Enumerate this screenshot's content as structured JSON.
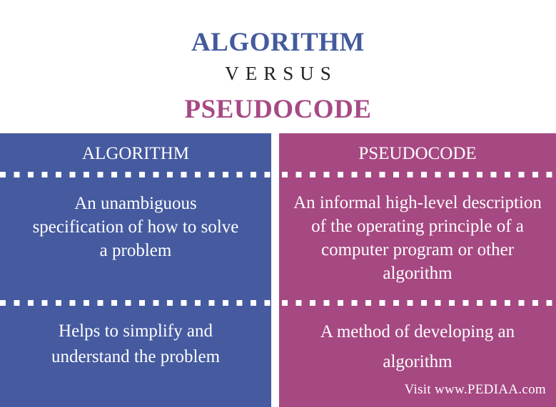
{
  "title": {
    "left": "ALGORITHM",
    "versus": "VERSUS",
    "right": "PSEUDOCODE"
  },
  "colors": {
    "algorithm": "#455a9f",
    "pseudocode": "#a64882",
    "text_on_panel": "#ffffff"
  },
  "columns": [
    {
      "header": "ALGORITHM",
      "rows": [
        "An unambiguous specification of how to solve a problem",
        "Helps to simplify and understand the problem"
      ]
    },
    {
      "header": "PSEUDOCODE",
      "rows": [
        "An informal high-level description of the operating principle of a computer program or other algorithm",
        "A method of developing an algorithm"
      ]
    }
  ],
  "footer": "Visit www.PEDIAA.com"
}
